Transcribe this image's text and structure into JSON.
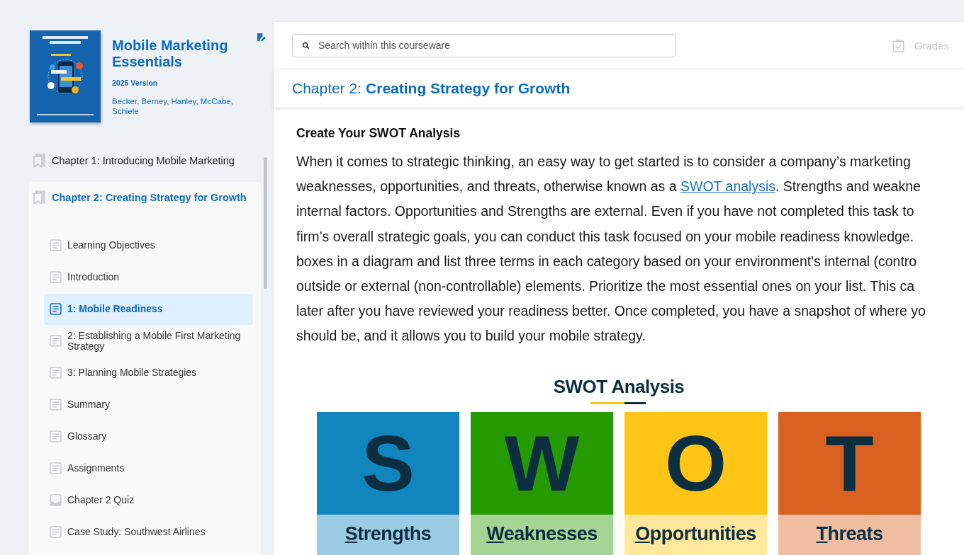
{
  "sidebar": {
    "book": {
      "title": "Mobile Marketing Essentials",
      "version": "2025 Version",
      "authors": "Becker, Berney, Hanley, McCabe, Schiele"
    },
    "chapters": [
      {
        "title": "Chapter 1: Introducing Mobile Marketing",
        "expanded": false
      },
      {
        "title": "Chapter 2: Creating Strategy for Growth",
        "expanded": true,
        "children": [
          {
            "label": "Learning Objectives",
            "kind": "page",
            "selected": false
          },
          {
            "label": "Introduction",
            "kind": "page",
            "selected": false
          },
          {
            "label": "1: Mobile Readiness",
            "kind": "page",
            "selected": true
          },
          {
            "label": "2: Establishing a Mobile First Marketing Strategy",
            "kind": "page",
            "selected": false
          },
          {
            "label": "3: Planning Mobile Strategies",
            "kind": "page",
            "selected": false
          },
          {
            "label": "Summary",
            "kind": "page",
            "selected": false
          },
          {
            "label": "Glossary",
            "kind": "page",
            "selected": false
          },
          {
            "label": "Assignments",
            "kind": "page",
            "selected": false
          },
          {
            "label": "Chapter 2 Quiz",
            "kind": "quiz",
            "selected": false
          },
          {
            "label": "Case Study: Southwest Airlines",
            "kind": "page",
            "selected": false
          }
        ]
      }
    ]
  },
  "search": {
    "placeholder": "Search within this courseware"
  },
  "grades": {
    "label": "Grades",
    "disabled": true
  },
  "chapter_heading": {
    "prefix": "Chapter 2:",
    "title": "Creating Strategy for Growth"
  },
  "article": {
    "heading": "Create Your SWOT Analysis",
    "lines": [
      {
        "text": "When it comes to strategic thinking, an easy way to get started is to consider a company’s marketing"
      },
      {
        "text": "weaknesses, opportunities, and threats, otherwise known as a ",
        "link": "SWOT analysis",
        "after": ". Strengths and weakne"
      },
      {
        "text": "internal factors. Opportunities and Strengths are external. Even if you have not completed this task to"
      },
      {
        "text": "firm’s overall strategic goals, you can conduct this task focused on your mobile readiness knowledge."
      },
      {
        "text": "boxes in a diagram and list three terms in each category based on your environment's internal (contro"
      },
      {
        "text": "outside or external (non-controllable) elements. Prioritize the most essential ones on your list. This ca"
      },
      {
        "text": "later after you have reviewed your readiness better. Once completed, you have a snapshot of where yo"
      },
      {
        "text": "should be, and it allows you to build your mobile strategy."
      }
    ]
  },
  "swot": {
    "title": "SWOT Analysis",
    "quadrants": [
      {
        "letter": "S",
        "label": "Strengths",
        "color": "#1085be"
      },
      {
        "letter": "W",
        "label": "Weaknesses",
        "color": "#269b00"
      },
      {
        "letter": "O",
        "label": "Opportunities",
        "color": "#fec514"
      },
      {
        "letter": "T",
        "label": "Threats",
        "color": "#d9611f"
      }
    ]
  }
}
